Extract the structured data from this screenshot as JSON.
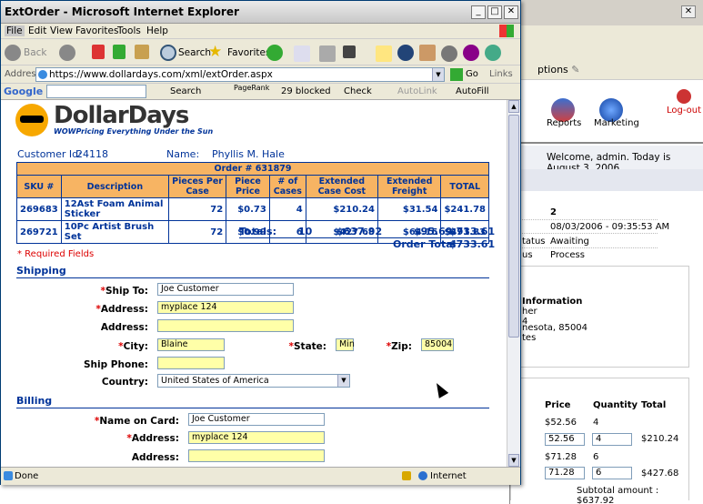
{
  "window": {
    "title": "ExtOrder - Microsoft Internet Explorer"
  },
  "menu": [
    "File",
    "Edit",
    "View",
    "Favorites",
    "Tools",
    "Help"
  ],
  "toolbar": {
    "back": "Back",
    "search": "Search",
    "favorites": "Favorites"
  },
  "address": {
    "label": "Address",
    "url": "https://www.dollardays.com/xml/extOrder.aspx",
    "go": "Go",
    "links": "Links"
  },
  "google": {
    "brand": "Google",
    "search": "Search",
    "pagerank": "PageRank",
    "blocked": "29 blocked",
    "check": "Check",
    "autolink": "AutoLink",
    "autofill": "AutoFill"
  },
  "status": {
    "left": "Done",
    "zone": "Internet"
  },
  "logo": {
    "name": "DollarDays",
    "tagline": "WOWPricing Everything Under the Sun"
  },
  "customer": {
    "id_label": "Customer Id:",
    "id": "24118",
    "name_label": "Name:",
    "name": "Phyllis M. Hale"
  },
  "order": {
    "title": "Order # 631879",
    "headers": [
      "SKU #",
      "Description",
      "Pieces Per Case",
      "Piece Price",
      "# of Cases",
      "Extended Case Cost",
      "Extended Freight",
      "TOTAL"
    ],
    "rows": [
      [
        "269683",
        "12Ast Foam Animal Sticker",
        "72",
        "$0.73",
        "4",
        "$210.24",
        "$31.54",
        "$241.78"
      ],
      [
        "269721",
        "10Pc Artist Brush Set",
        "72",
        "$0.99",
        "6",
        "$427.68",
        "$64.15",
        "$491.83"
      ]
    ],
    "totals_label": "Totals:",
    "totals_cases": "10",
    "totals_cost": "$637.92",
    "totals_freight": "$95.69",
    "totals_total": "$733.61",
    "order_total_label": "Order Total",
    "order_total": "$733.61"
  },
  "form": {
    "required_note": "* Required Fields",
    "shipping_title": "Shipping",
    "billing_title": "Billing",
    "ship_to_label": "Ship To:",
    "ship_to": "Joe Customer",
    "address_label": "Address:",
    "address1": "myplace 124",
    "address2": "",
    "city_label": "City:",
    "city": "Blaine",
    "state_label": "State:",
    "state": "Min",
    "zip_label": "Zip:",
    "zip": "85004",
    "phone_label": "Ship Phone:",
    "phone": "",
    "country_label": "Country:",
    "country": "United States of America",
    "card_name_label": "Name on Card:",
    "card_name": "Joe Customer",
    "bill_address1": "myplace 124",
    "bill_address2": ""
  },
  "bg": {
    "options": "ptions",
    "reports": "Reports",
    "marketing": "Marketing",
    "logout": "Log-out",
    "welcome": "Welcome, admin. Today is August 3, 2006.",
    "v1": "2",
    "v2": "08/03/2006 - 09:35:53 AM",
    "status_lbl": "tatus",
    "status_val": "Awaiting",
    "us_lbl": "us",
    "us_val": "Process",
    "info_title": "Information",
    "info1": "her",
    "info2": "4",
    "info3": "nesota, 85004",
    "info4": "tes",
    "col_price": "Price",
    "col_qty": "Quantity",
    "col_total": "Total",
    "r1_price": "$52.56",
    "r1_qty": "4",
    "r1_in_price": "52.56",
    "r1_in_qty": "4",
    "r1_total": "$210.24",
    "r2_price": "$71.28",
    "r2_qty": "6",
    "r2_in_price": "71.28",
    "r2_in_qty": "6",
    "r2_total": "$427.68",
    "subtotal": "Subtotal amount : $637.92"
  }
}
